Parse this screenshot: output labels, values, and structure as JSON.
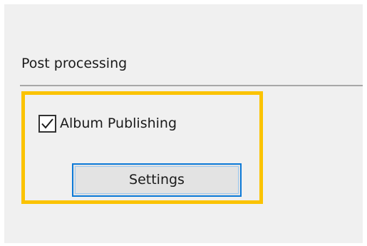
{
  "post_processing": {
    "group_title": "Post processing",
    "album_publishing": {
      "label": "Album Publishing",
      "checked": true
    },
    "settings_button": {
      "label": "Settings"
    }
  },
  "colors": {
    "highlight": "#fbc300",
    "button_border": "#0d7ad8",
    "panel_background": "#f0f0f0"
  },
  "icons": {
    "checkbox_check": "check-icon"
  }
}
